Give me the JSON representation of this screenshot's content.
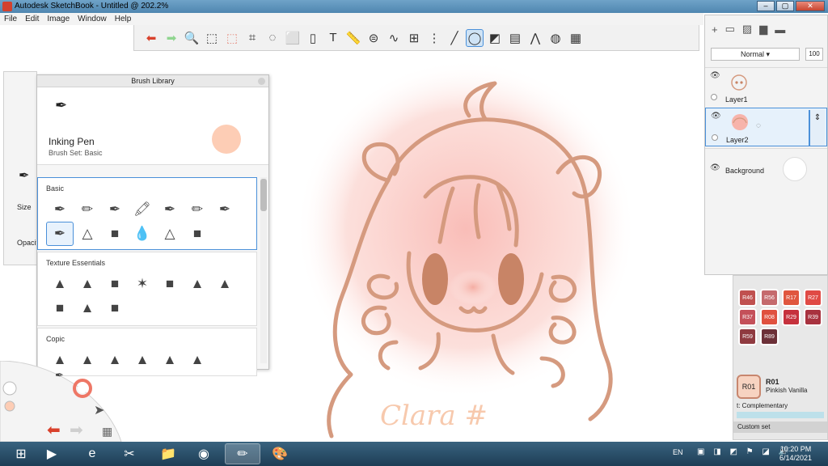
{
  "window": {
    "title": "Autodesk SketchBook - Untitled @ 202.2%",
    "buttons": [
      "–",
      "▢",
      "✕"
    ]
  },
  "menu": [
    "File",
    "Edit",
    "Image",
    "Window",
    "Help"
  ],
  "toolbar": {
    "tools": [
      {
        "name": "undo-icon",
        "glyph": "⬅"
      },
      {
        "name": "redo-icon",
        "glyph": "➡"
      },
      {
        "name": "zoom-icon",
        "glyph": "🔍"
      },
      {
        "name": "select-icon",
        "glyph": "⬚"
      },
      {
        "name": "select-alt-icon",
        "glyph": "⬚"
      },
      {
        "name": "crop-icon",
        "glyph": "⌗"
      },
      {
        "name": "lasso-icon",
        "glyph": "◌"
      },
      {
        "name": "transform-icon",
        "glyph": "⬜"
      },
      {
        "name": "fill-icon",
        "glyph": "▯"
      },
      {
        "name": "text-icon",
        "glyph": "T"
      },
      {
        "name": "ruler-icon",
        "glyph": "📏"
      },
      {
        "name": "ellipse-guide-icon",
        "glyph": "⊜"
      },
      {
        "name": "curve-icon",
        "glyph": "∿"
      },
      {
        "name": "perspective-icon",
        "glyph": "⊞"
      },
      {
        "name": "symmetry-icon",
        "glyph": "⋮"
      },
      {
        "name": "stroke-icon",
        "glyph": "╱"
      },
      {
        "name": "ellipse-icon",
        "glyph": "◯"
      },
      {
        "name": "shape-icon",
        "glyph": "◩"
      },
      {
        "name": "copic-icon",
        "glyph": "▤"
      },
      {
        "name": "brush-library-icon",
        "glyph": "⋀"
      },
      {
        "name": "color-wheel-icon",
        "glyph": "◍"
      },
      {
        "name": "layers-icon",
        "glyph": "▦"
      }
    ],
    "active_tool": "ellipse-icon"
  },
  "brush_palette": {
    "size_label": "Size",
    "opacity_label": "Opacit"
  },
  "brush_library": {
    "title": "Brush Library",
    "brush_name": "Inking Pen",
    "brush_set": "Brush Set: Basic",
    "color": "#fdcdb5",
    "sets": [
      {
        "title": "Basic",
        "brushes": [
          "✒",
          "✏",
          "✒",
          "🖍",
          "✒",
          "✏",
          "✒",
          "✒",
          "△",
          "■",
          "💧",
          "△",
          "■"
        ]
      },
      {
        "title": "Texture Essentials",
        "brushes": [
          "▲",
          "▲",
          "■",
          "✶",
          "■",
          "▲",
          "▲",
          "■",
          "▲",
          "■"
        ]
      },
      {
        "title": "Copic",
        "brushes": [
          "▲",
          "▲",
          "▲",
          "▲",
          "▲",
          "▲"
        ]
      }
    ],
    "selected_brush": "Inking Pen"
  },
  "layers": {
    "toolbar_icons": [
      "+",
      "▭",
      "▨",
      "▆",
      "▬"
    ],
    "blend_mode": "Normal",
    "opacity": "100",
    "items": [
      {
        "name": "Layer1"
      },
      {
        "name": "Layer2"
      },
      {
        "name": "Background"
      }
    ],
    "selected": "Layer2"
  },
  "copic": {
    "swatches": [
      {
        "code": "R46",
        "color": "#c0504f"
      },
      {
        "code": "R56",
        "color": "#c56a6d"
      },
      {
        "code": "R17",
        "color": "#e0563e"
      },
      {
        "code": "R27",
        "color": "#e04a45"
      },
      {
        "code": "R37",
        "color": "#c4505a"
      },
      {
        "code": "R08",
        "color": "#e0513f"
      },
      {
        "code": "R29",
        "color": "#c6313d"
      },
      {
        "code": "R39",
        "color": "#a8323f"
      },
      {
        "code": "R59",
        "color": "#8f3a40"
      },
      {
        "code": "R89",
        "color": "#6c3038"
      }
    ],
    "selected_code": "R01",
    "selected_name": "Pinkish Vanilla",
    "complementary_label": "Complementary",
    "custom_set_label": "Custom set"
  },
  "taskbar": {
    "apps": [
      "⊞",
      "▶",
      "e",
      "✂",
      "📁",
      "◉",
      "✏",
      "🎨"
    ],
    "active_index": 6,
    "language": "EN",
    "time": "10:20 PM",
    "date": "6/14/2021"
  },
  "canvas": {
    "signature_text": "Clara #",
    "line_color": "#d59a7f",
    "blush_color": "#f7a7a0"
  }
}
